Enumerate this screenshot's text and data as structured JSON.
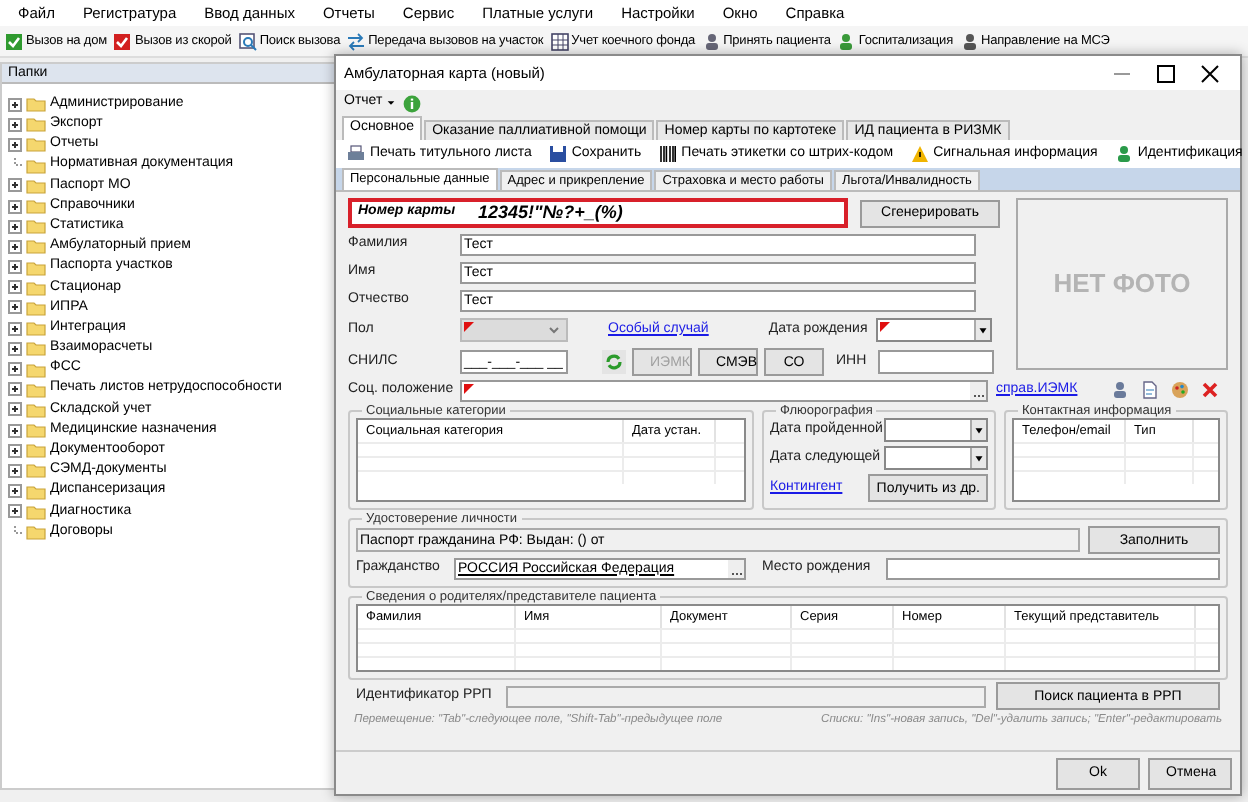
{
  "menu": [
    "Файл",
    "Регистратура",
    "Ввод данных",
    "Отчеты",
    "Сервис",
    "Платные услуги",
    "Настройки",
    "Окно",
    "Справка"
  ],
  "toolbar": [
    "Вызов на дом",
    "Вызов из скорой",
    "Поиск вызова",
    "Передача вызовов на участок",
    "Учет коечного фонда",
    "Принять пациента",
    "Госпитализация",
    "Направление на МСЭ"
  ],
  "sidebar": {
    "title": "Папки",
    "items": [
      {
        "label": "Администрирование",
        "expandable": true
      },
      {
        "label": "Экспорт",
        "expandable": true
      },
      {
        "label": "Отчеты",
        "expandable": true
      },
      {
        "label": "Нормативная документация",
        "expandable": false
      },
      {
        "label": "Паспорт МО",
        "expandable": true
      },
      {
        "label": "Справочники",
        "expandable": true
      },
      {
        "label": "Статистика",
        "expandable": true
      },
      {
        "label": "Амбулаторный прием",
        "expandable": true
      },
      {
        "label": "Паспорта участков",
        "expandable": true
      },
      {
        "label": "Стационар",
        "expandable": true
      },
      {
        "label": "ИПРА",
        "expandable": true
      },
      {
        "label": "Интеграция",
        "expandable": true
      },
      {
        "label": "Взаиморасчеты",
        "expandable": true
      },
      {
        "label": "ФСС",
        "expandable": true
      },
      {
        "label": "Печать листов нетрудоспособности",
        "expandable": true
      },
      {
        "label": "Складской учет",
        "expandable": true
      },
      {
        "label": "Медицинские назначения",
        "expandable": true
      },
      {
        "label": "Документооборот",
        "expandable": true
      },
      {
        "label": "СЭМД-документы",
        "expandable": true
      },
      {
        "label": "Диспансеризация",
        "expandable": true
      },
      {
        "label": "Диагностика",
        "expandable": true
      },
      {
        "label": "Договоры",
        "expandable": false
      }
    ]
  },
  "dialog": {
    "title": "Амбулаторная карта (новый)",
    "report_menu": "Отчет",
    "tabs": [
      {
        "label": "Основное",
        "selected": true
      },
      {
        "label": "Оказание паллиативной помощи",
        "selected": false
      },
      {
        "label": "Номер карты по картотеке",
        "selected": false
      },
      {
        "label": "ИД пациента в РИЗМК",
        "selected": false
      }
    ],
    "toolbar": [
      "Печать титульного листа",
      "Сохранить",
      "Печать этикетки со штрих-кодом",
      "Сигнальная информация",
      "Идентификация"
    ],
    "subtabs": [
      {
        "label": "Персональные данные",
        "selected": true
      },
      {
        "label": "Адрес и прикрепление",
        "selected": false
      },
      {
        "label": "Страховка и место работы",
        "selected": false
      },
      {
        "label": "Льгота/Инвалидность",
        "selected": false
      }
    ],
    "card_number": {
      "label": "Номер карты",
      "value": "12345!\"№?+_(%)"
    },
    "generate_button": "Сгенерировать",
    "photo": "НЕТ ФОТО",
    "names": [
      {
        "label": "Фамилия",
        "value": "Тест"
      },
      {
        "label": "Имя",
        "value": "Тест"
      },
      {
        "label": "Отчество",
        "value": "Тест"
      }
    ],
    "sex": {
      "label": "Пол",
      "required": true,
      "disabled": true
    },
    "special_case_link": "Особый случай",
    "birth_date": {
      "label": "Дата рождения",
      "required": true
    },
    "snils": {
      "label": "СНИЛС",
      "value": "___-___-___ __"
    },
    "snils_buttons": [
      {
        "label": "ИЭМК",
        "disabled": true
      },
      {
        "label": "СМЭВ",
        "disabled": false
      },
      {
        "label": "СО",
        "disabled": false
      }
    ],
    "inn": {
      "label": "ИНН"
    },
    "social_status": {
      "label": "Соц. положение",
      "required": true
    },
    "iemk_link": "справ.ИЭМК",
    "social_categories": {
      "title": "Социальные категории",
      "columns": [
        "Социальная категория",
        "Дата устан."
      ]
    },
    "fluorography": {
      "title": "Флюорография",
      "fields": [
        "Дата пройденной",
        "Дата следующей"
      ],
      "link": "Контингент",
      "button": "Получить из др."
    },
    "contacts": {
      "title": "Контактная информация",
      "columns": [
        "Телефон/email",
        "Тип"
      ]
    },
    "identity": {
      "title": "Удостоверение личности",
      "document": "Паспорт гражданина РФ:  Выдан: () от",
      "fill_button": "Заполнить",
      "citizenship": {
        "label": "Гражданство",
        "value": "РОССИЯ Российская Федерация"
      },
      "birthplace": {
        "label": "Место рождения"
      }
    },
    "parents": {
      "title": "Сведения о родителях/представителе пациента",
      "columns": [
        "Фамилия",
        "Имя",
        "Документ",
        "Серия",
        "Номер",
        "Текущий представитель"
      ]
    },
    "rrp": {
      "label": "Идентификатор РРП",
      "button": "Поиск пациента в РРП"
    },
    "hints": [
      "Перемещение: \"Tab\"-следующее поле, \"Shift-Tab\"-предыдущее поле",
      "Списки: \"Ins\"-новая запись, \"Del\"-удалить запись; \"Enter\"-редактировать"
    ],
    "buttons": [
      "Ok",
      "Отмена"
    ]
  }
}
